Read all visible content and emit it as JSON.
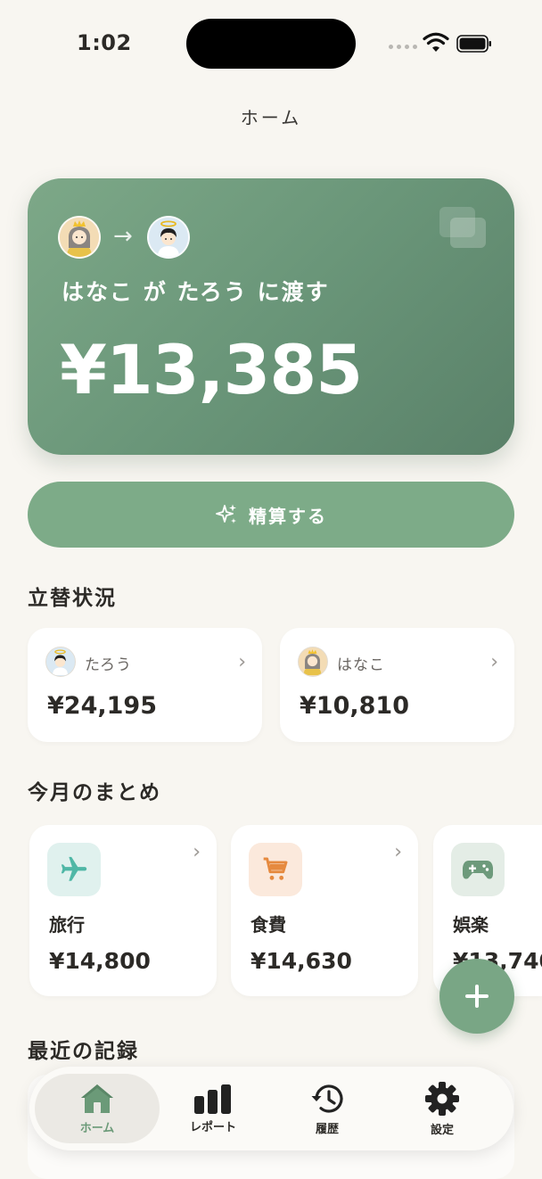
{
  "status_bar": {
    "time": "1:02"
  },
  "nav": {
    "title": "ホーム"
  },
  "hero": {
    "from_avatar": "crowned-girl-avatar",
    "to_avatar": "angel-boy-avatar",
    "subtitle": "はなこ が たろう に渡す",
    "amount": "¥13,385",
    "accent_color": "#6d9a7b"
  },
  "settle_button": {
    "label": "精算する",
    "icon": "sparkles-icon"
  },
  "balance_section": {
    "title": "立替状況",
    "items": [
      {
        "name": "たろう",
        "amount": "¥24,195",
        "avatar": "angel-boy-avatar"
      },
      {
        "name": "はなこ",
        "amount": "¥10,810",
        "avatar": "crowned-girl-avatar"
      }
    ]
  },
  "summary_section": {
    "title": "今月のまとめ",
    "items": [
      {
        "label": "旅行",
        "amount": "¥14,800",
        "icon": "airplane-icon",
        "color": "#4fb7a6"
      },
      {
        "label": "食費",
        "amount": "¥14,630",
        "icon": "cart-icon",
        "color": "#e68a3f"
      },
      {
        "label": "娯楽",
        "amount": "¥13,740",
        "icon": "gamepad-icon",
        "color": "#6d9a7b"
      }
    ]
  },
  "recent_section": {
    "title": "最近の記録"
  },
  "fab": {
    "icon": "plus-icon"
  },
  "tabbar": {
    "tabs": [
      {
        "label": "ホーム",
        "icon": "house-icon",
        "active": true
      },
      {
        "label": "レポート",
        "icon": "bar-chart-icon",
        "active": false
      },
      {
        "label": "履歴",
        "icon": "history-icon",
        "active": false
      },
      {
        "label": "設定",
        "icon": "gear-icon",
        "active": false
      }
    ]
  }
}
